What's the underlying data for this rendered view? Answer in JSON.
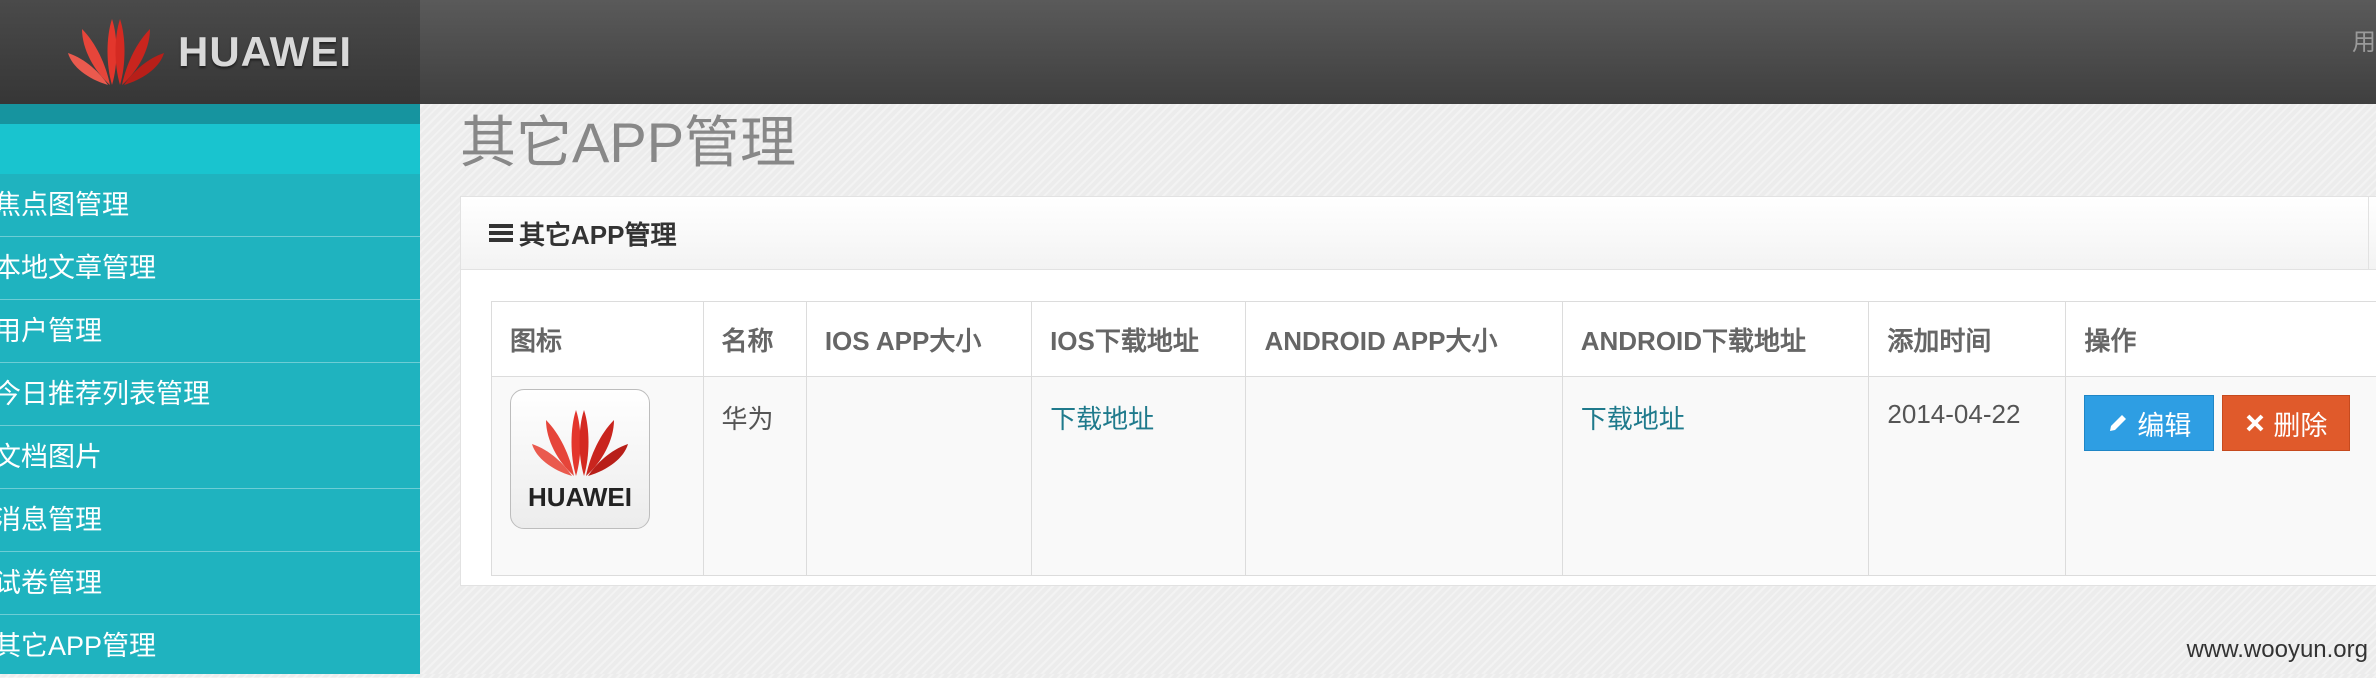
{
  "brand": {
    "name": "HUAWEI"
  },
  "topbar": {
    "user_text": "用"
  },
  "sidebar": {
    "items": [
      {
        "label": "焦点图管理"
      },
      {
        "label": "本地文章管理"
      },
      {
        "label": "用户管理"
      },
      {
        "label": "今日推荐列表管理"
      },
      {
        "label": "文档图片"
      },
      {
        "label": "消息管理"
      },
      {
        "label": "试卷管理"
      },
      {
        "label": "其它APP管理"
      }
    ]
  },
  "page": {
    "title": "其它APP管理"
  },
  "panel": {
    "title": "其它APP管理",
    "columns": [
      "图标",
      "名称",
      "IOS APP大小",
      "IOS下载地址",
      "ANDROID APP大小",
      "ANDROID下载地址",
      "添加时间",
      "操作"
    ],
    "rows": [
      {
        "icon_label": "HUAWEI",
        "name": "华为",
        "ios_size": "",
        "ios_link": "下载地址",
        "android_size": "",
        "android_link": "下载地址",
        "added": "2014-04-22",
        "edit_label": "编辑",
        "delete_label": "删除"
      }
    ]
  },
  "colors": {
    "sidebar": "#1fb3bf",
    "topbar": "#3f3f3f",
    "edit_button": "#2e9ee3",
    "delete_button": "#e05a2b",
    "link": "#1f7a8c"
  },
  "icons": [
    "huawei-logo",
    "list-icon",
    "pencil-icon",
    "times-icon"
  ],
  "watermark": "www.wooyun.org"
}
